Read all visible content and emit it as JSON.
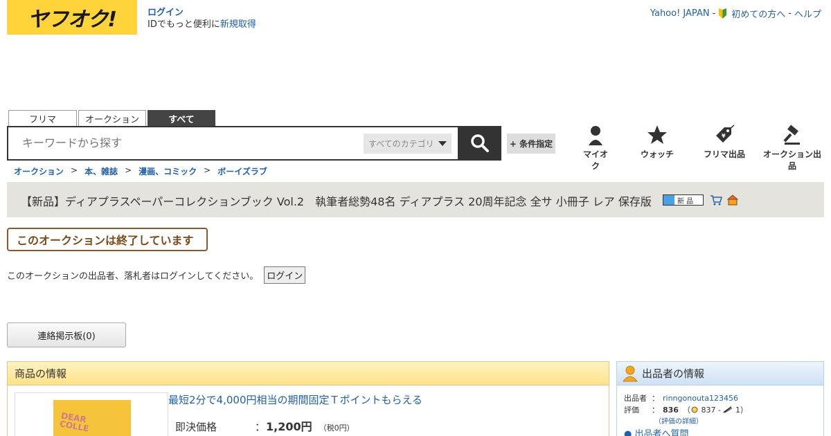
{
  "header": {
    "logo": "ヤフオク!",
    "login": "ログイン",
    "login_sub_prefix": "IDでもっと便利に",
    "register": "新規取得",
    "yahoo_japan": "Yahoo! JAPAN",
    "beginner": "初めての方へ",
    "help": "ヘルプ",
    "sep": "-"
  },
  "search": {
    "tabs": [
      "フリマ",
      "オークション",
      "すべて"
    ],
    "placeholder": "キーワードから探す",
    "category": "すべてのカテゴリ",
    "conditions": "+ 条件指定"
  },
  "nav": {
    "myauc": "マイオク",
    "watch": "ウォッチ",
    "flea_sell": "フリマ出品",
    "auction_sell": "オークション出品"
  },
  "breadcrumb": [
    "オークション",
    "本、雑誌",
    "漫画、コミック",
    "ボーイズラブ"
  ],
  "breadcrumb_sep": ">",
  "item": {
    "title": "【新品】ディアプラスペーパーコレクションブック Vol.2　執筆者総勢48名 ディアプラス 20周年記念 全サ 小冊子 レア 保存版",
    "badge_new": "新 品",
    "ended": "このオークションは終了しています",
    "login_note": "このオークションの出品者、落札者はログインしてください。",
    "login_button": "ログイン",
    "board_button": "連絡掲示板(0)"
  },
  "info": {
    "heading": "商品の情報",
    "thumb_text": "DEAR\nCOLLE",
    "tpoint": "最短2分で4,000円相当の期間固定Ｔポイントもらえる",
    "price_label": "即決価格",
    "colon": "：",
    "price": "1,200円",
    "tax": "（税0円）"
  },
  "seller": {
    "heading": "出品者の情報",
    "label_seller": "出品者",
    "seller_id": "rinngonouta123456",
    "label_rating": "評価",
    "colon": "：",
    "score": "836",
    "good": "837",
    "bad": "1",
    "detail": "（評価の詳細）",
    "more": "出品者へ質問"
  },
  "colors": {
    "logo_bg": "#ffd43b",
    "link": "#2160a9",
    "title_bar": "#e5e3de",
    "ended_border": "#8a5a2b"
  }
}
